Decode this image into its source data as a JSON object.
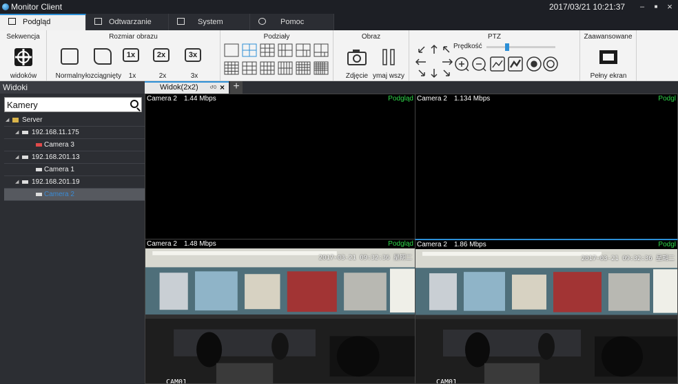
{
  "window": {
    "title": "Monitor Client",
    "datetime": "2017/03/21 10:21:37",
    "minimize": "–",
    "maximize": "■",
    "close": "×"
  },
  "tabs": [
    {
      "label": "Podgląd",
      "icon": "monitor-icon",
      "active": true
    },
    {
      "label": "Odtwarzanie",
      "icon": "play-icon",
      "active": false
    },
    {
      "label": "System",
      "icon": "folder-icon",
      "active": false
    },
    {
      "label": "Pomoc",
      "icon": "help-icon",
      "active": false
    }
  ],
  "ribbon": {
    "sekwencja": {
      "title": "Sekwencja",
      "button": "widoków"
    },
    "rozmiar": {
      "title": "Rozmiar obrazu",
      "normal": "Normalny",
      "stretch": "łozciągnięty",
      "x1": "1x",
      "x2": "2x",
      "x3": "3x",
      "x1_icon": "1x",
      "x2_icon": "2x",
      "x3_icon": "3x"
    },
    "podzialy": {
      "title": "Podziały"
    },
    "obraz": {
      "title": "Obraz",
      "snapshot": "Zdjęcie",
      "pause": "ymaj wszy"
    },
    "ptz": {
      "title": "PTZ",
      "speed": "Prędkość",
      "speed_level": 0.3
    },
    "zaawansowane": {
      "title": "Zaawansowane",
      "fullscreen": "Pełny ekran"
    }
  },
  "left_panel": {
    "header": "Widoki",
    "search_text": "Kamery",
    "tree": [
      {
        "label": "Server",
        "type": "server",
        "level": 0
      },
      {
        "label": "192.168.11.175",
        "type": "device",
        "level": 1
      },
      {
        "label": "Camera 3",
        "type": "camera-offline",
        "level": 2
      },
      {
        "label": "192.168.201.13",
        "type": "device",
        "level": 1
      },
      {
        "label": "Camera 1",
        "type": "camera",
        "level": 2
      },
      {
        "label": "192.168.201.19",
        "type": "device",
        "level": 1
      },
      {
        "label": "Camera 2",
        "type": "camera",
        "level": 2,
        "selected": true
      }
    ]
  },
  "view_tab": {
    "label": "Widok(2x2)",
    "mark": "↺0",
    "close": "×",
    "add": "+"
  },
  "cells": [
    {
      "camera": "Camera 2",
      "rate": "1.44 Mbps",
      "status": "Podgląd",
      "has_video": false
    },
    {
      "camera": "Camera 2",
      "rate": "1.134 Mbps",
      "status": "Podgl",
      "has_video": false
    },
    {
      "camera": "Camera 2",
      "rate": "1.48 Mbps",
      "status": "Podgląd",
      "has_video": true,
      "osd": "2017-03-21 09:32:36 星期二",
      "label": "CAM01"
    },
    {
      "camera": "Camera 2",
      "rate": "1.86 Mbps",
      "status": "Podgl",
      "has_video": true,
      "osd": "2017-03-21 09:32:36 星期二",
      "label": "CAM01",
      "active": true
    }
  ],
  "colors": {
    "accent": "#2c8fd6",
    "status_green": "#2fd84a",
    "panel_bg": "#2c2e33",
    "ribbon_bg": "#f3f3f3"
  }
}
